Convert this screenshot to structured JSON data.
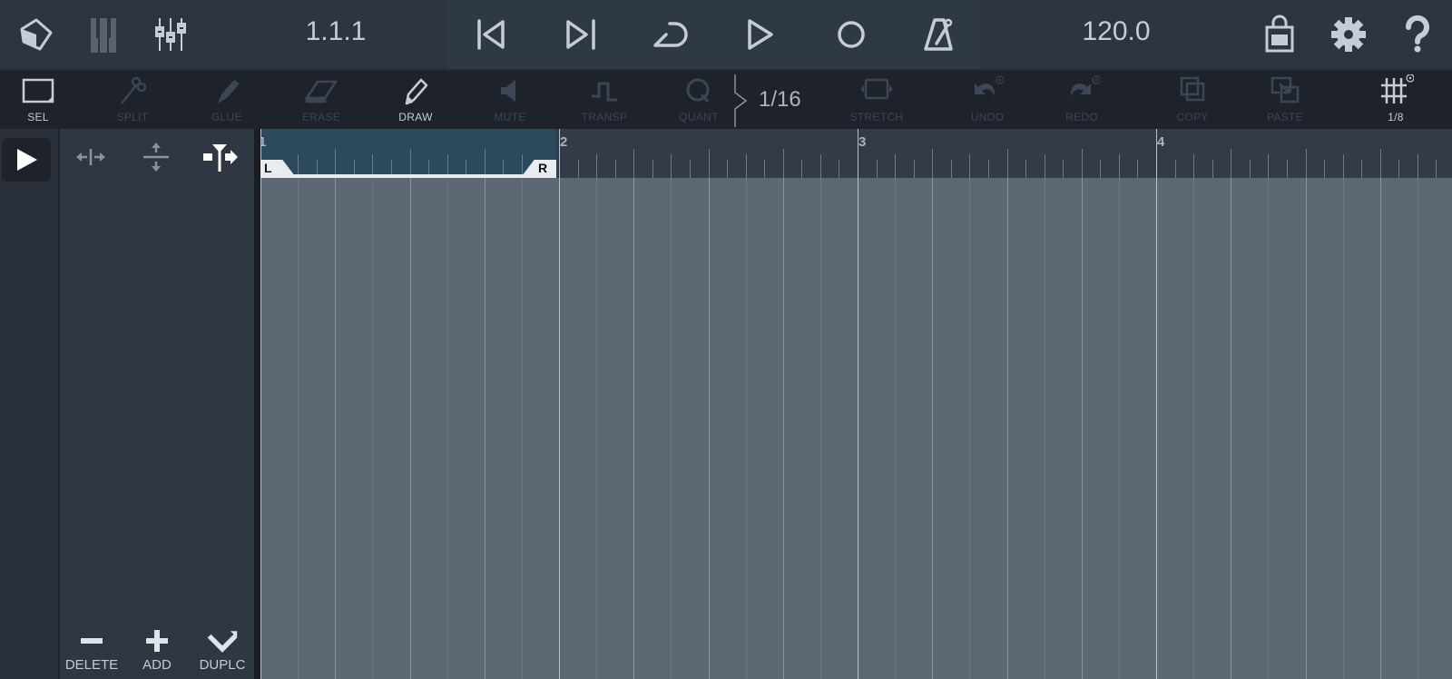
{
  "topbar": {
    "left_icons": [
      {
        "name": "arrange-cube-icon"
      },
      {
        "name": "piano-keys-icon"
      },
      {
        "name": "mixer-icon"
      }
    ],
    "position": "1.1.1",
    "transport": [
      {
        "name": "rewind-to-start-icon"
      },
      {
        "name": "skip-to-end-icon"
      },
      {
        "name": "loop-icon"
      },
      {
        "name": "play-icon"
      },
      {
        "name": "record-icon"
      },
      {
        "name": "metronome-icon"
      }
    ],
    "tempo": "120.0",
    "right_icons": [
      {
        "name": "shop-bag-icon"
      },
      {
        "name": "settings-gear-icon"
      },
      {
        "name": "help-question-icon"
      }
    ]
  },
  "toolbar": {
    "tools": [
      {
        "label": "SEL",
        "active": true
      },
      {
        "label": "SPLIT",
        "active": false
      },
      {
        "label": "GLUE",
        "active": false
      },
      {
        "label": "ERASE",
        "active": false
      },
      {
        "label": "DRAW",
        "active": true
      },
      {
        "label": "MUTE",
        "active": false
      },
      {
        "label": "TRANSP",
        "active": false
      },
      {
        "label": "QUANT",
        "active": false
      },
      {
        "label": "STRETCH",
        "active": false
      },
      {
        "label": "UNDO",
        "active": false
      },
      {
        "label": "REDO",
        "active": false
      },
      {
        "label": "COPY",
        "active": false
      },
      {
        "label": "PASTE",
        "active": false
      },
      {
        "label": "1/8",
        "active": true
      }
    ],
    "quantize_value": "1/16"
  },
  "track_panel": {
    "buttons": [
      {
        "label": "DELETE"
      },
      {
        "label": "ADD"
      },
      {
        "label": "DUPLC"
      }
    ]
  },
  "ruler": {
    "bars": [
      "1",
      "2",
      "3",
      "4"
    ],
    "loop_left_label": "L",
    "loop_right_label": "R"
  },
  "colors": {
    "accent_loop": "#2b4a5e",
    "grid_bg": "#5c6975",
    "icon_active": "#c4ccd6",
    "icon_disabled": "#3c4654"
  }
}
